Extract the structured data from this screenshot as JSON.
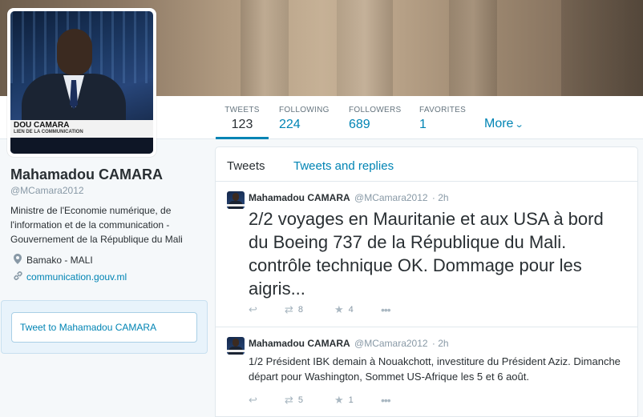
{
  "profile": {
    "name": "Mahamadou CAMARA",
    "handle": "@MCamara2012",
    "bio": "Ministre de l'Economie numérique, de l'information et de la communication - Gouvernement de la République du Mali",
    "location": "Bamako - MALI",
    "website": "communication.gouv.ml",
    "avatar_caption_line1": "DOU CAMARA",
    "avatar_caption_line2": "LIEN DE LA COMMUNICATION"
  },
  "stats": [
    {
      "label": "TWEETS",
      "value": "123",
      "active": true
    },
    {
      "label": "FOLLOWING",
      "value": "224"
    },
    {
      "label": "FOLLOWERS",
      "value": "689"
    },
    {
      "label": "FAVORITES",
      "value": "1"
    }
  ],
  "more_label": "More",
  "tweet_to": {
    "placeholder": "Tweet to Mahamadou CAMARA"
  },
  "timeline": {
    "tabs": [
      "Tweets",
      "Tweets and replies"
    ],
    "tweets": [
      {
        "name": "Mahamadou CAMARA",
        "handle": "@MCamara2012",
        "time": "· 2h",
        "text": "2/2 voyages en Mauritanie et aux USA à bord du Boeing 737 de la République du Mali. contrôle technique OK. Dommage pour les aigris...",
        "retweets": "8",
        "favorites": "4"
      },
      {
        "name": "Mahamadou CAMARA",
        "handle": "@MCamara2012",
        "time": "· 2h",
        "text": "1/2 Président IBK demain à Nouakchott, investiture du Président Aziz. Dimanche départ pour Washington, Sommet US-Afrique les 5 et 6 août.",
        "retweets": "5",
        "favorites": "1"
      }
    ]
  },
  "icons": {
    "location": "map-pin-icon",
    "link": "link-icon",
    "reply": "reply-icon",
    "retweet": "retweet-icon",
    "favorite": "star-icon",
    "more": "ellipsis-icon"
  },
  "colors": {
    "link": "#0084b4",
    "muted": "#8899a6",
    "text": "#292f33"
  }
}
